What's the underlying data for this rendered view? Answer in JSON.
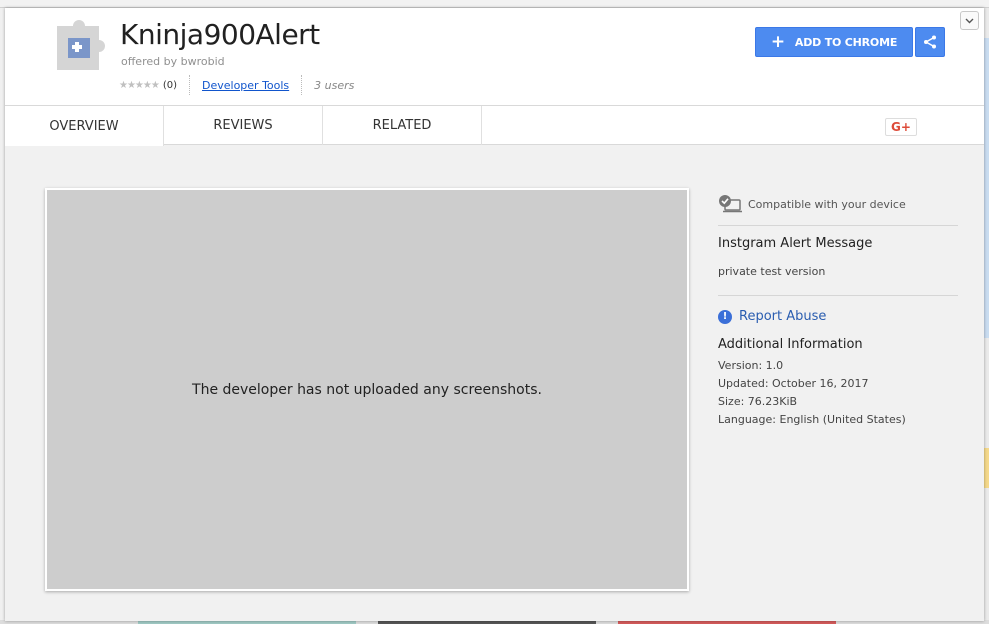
{
  "extension": {
    "title": "Kninja900Alert",
    "offered_by": "offered by bwrobid",
    "stars": "★★★★★",
    "rating_count": "(0)",
    "category": "Developer Tools",
    "users": "3 users"
  },
  "actions": {
    "add_label": "ADD TO CHROME",
    "add_icon": "plus-icon",
    "share_icon": "share-icon",
    "close_icon": "chevron-down-icon",
    "accent_color": "#4d8bf0"
  },
  "tabs": [
    {
      "label": "OVERVIEW",
      "active": true
    },
    {
      "label": "REVIEWS",
      "active": false
    },
    {
      "label": "RELATED",
      "active": false
    }
  ],
  "gplus_label": "G+",
  "main": {
    "no_screenshots": "The developer has not uploaded any screenshots."
  },
  "sidebar": {
    "compatible": "Compatible with your device",
    "description_title": "Instgram Alert Message",
    "description_text": "private test version",
    "report_abuse": "Report Abuse",
    "additional_info_title": "Additional Information",
    "version": "Version: 1.0",
    "updated": "Updated: October 16, 2017",
    "size": "Size: 76.23KiB",
    "language": "Language: English (United States)"
  }
}
